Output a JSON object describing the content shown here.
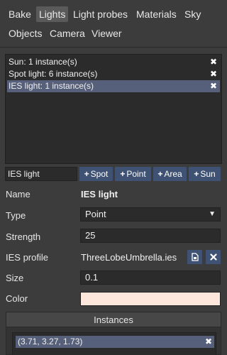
{
  "tabs": [
    {
      "label": "Bake",
      "active": false
    },
    {
      "label": "Lights",
      "active": true
    },
    {
      "label": "Light probes",
      "active": false
    },
    {
      "label": "Materials",
      "active": false
    },
    {
      "label": "Sky",
      "active": false
    },
    {
      "label": "Objects",
      "active": false
    },
    {
      "label": "Camera",
      "active": false
    },
    {
      "label": "Viewer",
      "active": false
    }
  ],
  "lights": [
    {
      "label": "Sun: 1 instance(s)",
      "selected": false,
      "remove_glyph": "✖"
    },
    {
      "label": "Spot light: 6 instance(s)",
      "selected": false,
      "remove_glyph": "✖"
    },
    {
      "label": "IES light: 1 instance(s)",
      "selected": true,
      "remove_glyph": "✖"
    }
  ],
  "add_bar": {
    "name_value": "IES light",
    "buttons": [
      {
        "label": "Spot",
        "icon": "plus-icon"
      },
      {
        "label": "Point",
        "icon": "plus-icon"
      },
      {
        "label": "Area",
        "icon": "plus-icon"
      },
      {
        "label": "Sun",
        "icon": "plus-icon"
      }
    ]
  },
  "properties": {
    "name": {
      "label": "Name",
      "value": "IES light"
    },
    "type": {
      "label": "Type",
      "value": "Point",
      "arrow": "▼"
    },
    "strength": {
      "label": "Strength",
      "value": "25"
    },
    "ies_profile": {
      "label": "IES profile",
      "value": "ThreeLobeUmbrella.ies",
      "icons": [
        "open-file-icon",
        "clear-icon"
      ]
    },
    "size": {
      "label": "Size",
      "value": "0.1"
    },
    "color": {
      "label": "Color",
      "value": "#fde6dc"
    }
  },
  "instances": {
    "header": "Instances",
    "items": [
      {
        "label": "(3.71, 3.27, 1.73)",
        "remove_glyph": "✖"
      }
    ]
  },
  "colors": {
    "background": "#3c3c3c",
    "accent": "#3f5273",
    "selection": "#56607a",
    "field": "#2b2b2b"
  }
}
